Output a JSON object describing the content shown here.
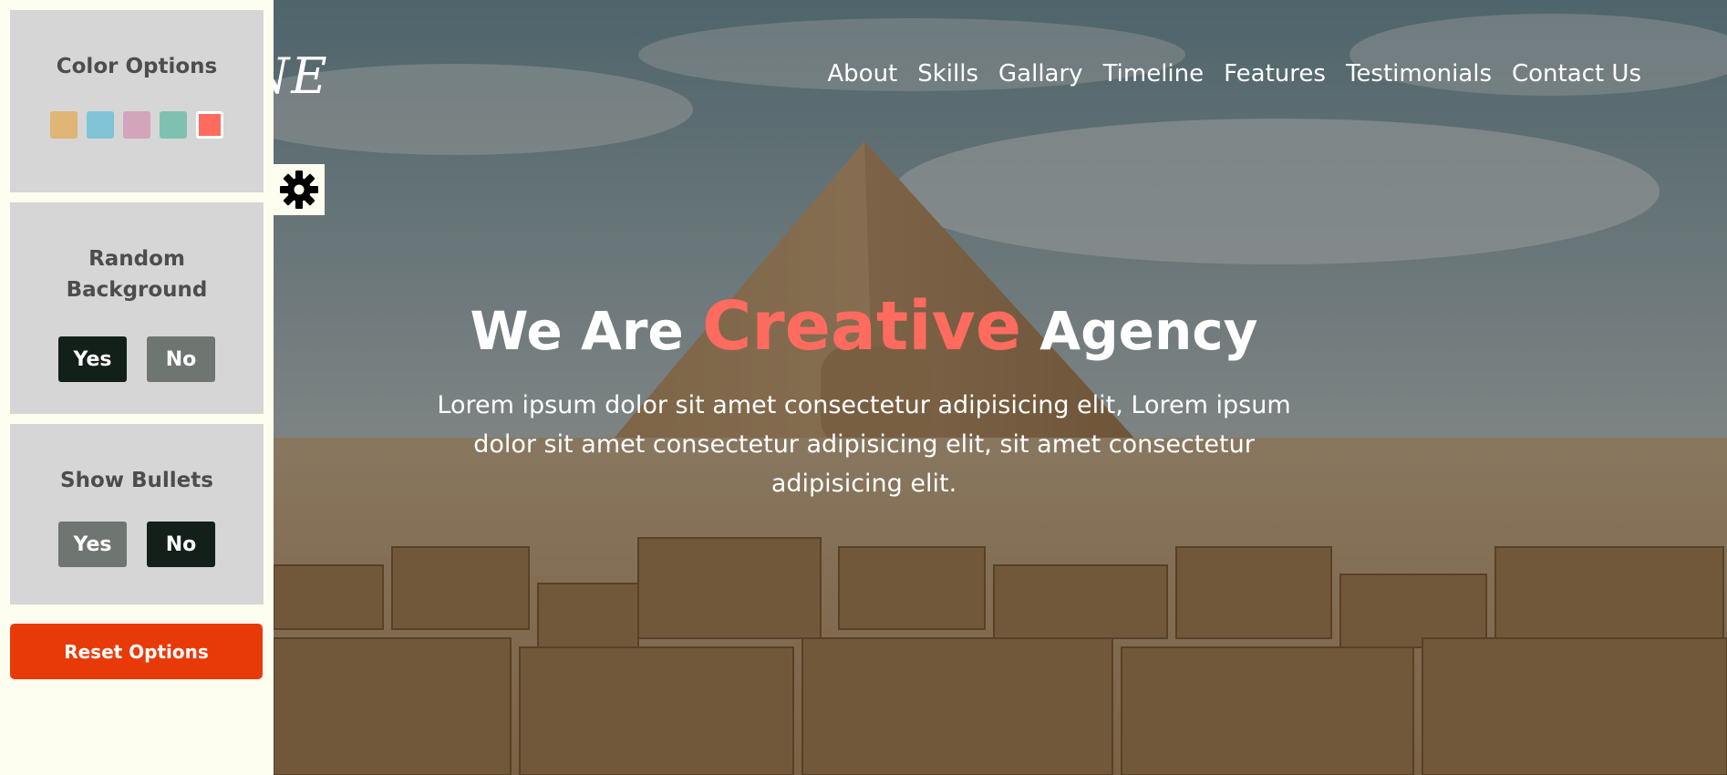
{
  "header": {
    "logo_text": "NE",
    "nav": [
      "About",
      "Skills",
      "Gallary",
      "Timeline",
      "Features",
      "Testimonials",
      "Contact Us"
    ]
  },
  "hero": {
    "title_prefix": "We Are",
    "title_accent": "Creative",
    "title_suffix": "Agency",
    "description": "Lorem ipsum dolor sit amet consectetur adipisicing elit, Lorem ipsum dolor sit amet consectetur adipisicing elit, sit amet consectetur adipisicing elit."
  },
  "settings": {
    "color_options": {
      "title": "Color Options",
      "colors": [
        "#deb574",
        "#80c3d7",
        "#d2a5bb",
        "#7fc1b1",
        "#ff6b5e"
      ],
      "active_color": "#ff6b5e"
    },
    "random_background": {
      "title": "Random Background",
      "yes_label": "Yes",
      "no_label": "No",
      "selected": "Yes"
    },
    "show_bullets": {
      "title": "Show Bullets",
      "yes_label": "Yes",
      "no_label": "No",
      "selected": "No"
    },
    "reset_label": "Reset Options",
    "gear_icon": "gear-icon"
  },
  "colors": {
    "accent": "#ff6b5e",
    "panel_bg": "#fdfdf0",
    "box_bg": "#d6d6d6",
    "reset_bg": "#e83a09",
    "selected_btn": "#13201a",
    "unselected_btn": "#6f7571"
  }
}
